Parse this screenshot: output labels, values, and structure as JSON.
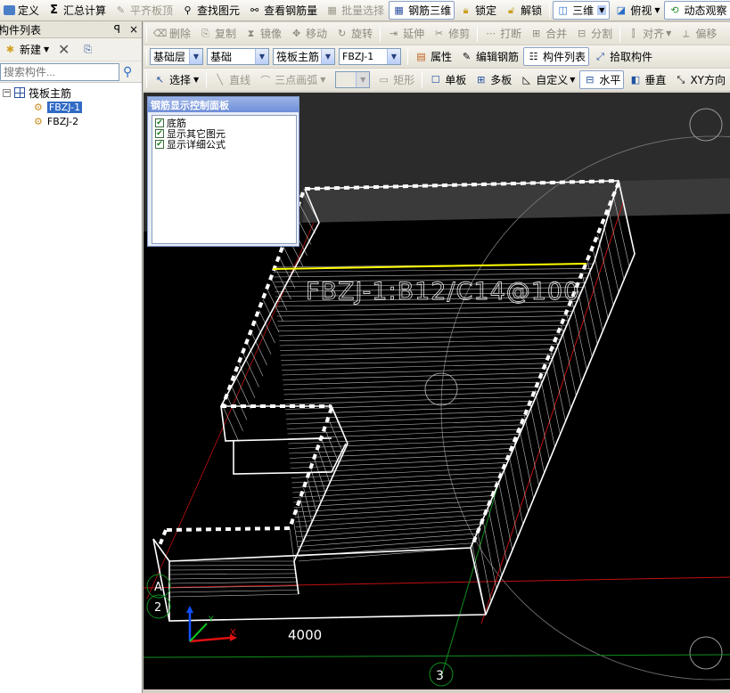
{
  "toolbar1": {
    "define": "定义",
    "sum": "汇总计算",
    "level": "平齐板顶",
    "find": "查找图元",
    "view_rebar": "查看钢筋量",
    "batch": "批量选择",
    "rebar3d": "钢筋三维",
    "lock": "锁定",
    "unlock": "解锁",
    "view_mode": "三维",
    "view_dir": "俯视",
    "dynamic": "动态观察"
  },
  "toolbar2": {
    "delete": "删除",
    "copy": "复制",
    "mirror": "镜像",
    "move": "移动",
    "rotate": "旋转",
    "extend": "延伸",
    "trim": "修剪",
    "break": "打断",
    "merge": "合并",
    "split": "分割",
    "align": "对齐",
    "offset": "偏移"
  },
  "toolbar3": {
    "floor": "基础层",
    "category": "基础",
    "type": "筏板主筋",
    "element": "FBZJ-1",
    "props": "属性",
    "edit_rebar": "编辑钢筋",
    "list": "构件列表",
    "pick": "拾取构件"
  },
  "toolbar4": {
    "select": "选择",
    "line": "直线",
    "arc": "三点画弧",
    "rect": "矩形",
    "single": "单板",
    "multi": "多板",
    "custom": "自定义",
    "horizontal": "水平",
    "vertical": "垂直",
    "xy": "XY方向"
  },
  "panel": {
    "title": "构件列表",
    "pin": "ꟼ",
    "close": "×",
    "new": "新建",
    "search_placeholder": "搜索构件...",
    "tree": {
      "root": "筏板主筋",
      "items": [
        "FBZJ-1",
        "FBZJ-2"
      ]
    }
  },
  "control_panel": {
    "title": "钢筋显示控制面板",
    "options": [
      "底筋",
      "显示其它图元",
      "显示详细公式"
    ]
  },
  "viewport": {
    "annotation": "FBZJ-1:B12/C14@100",
    "dimension": "4000",
    "axis_labels": [
      "A",
      "2",
      "3"
    ],
    "colors": {
      "rebar": "#ffffff",
      "highlight": "#ffff00",
      "axis_red": "#e01010",
      "axis_green": "#10a020",
      "axis_blue": "#1050ff"
    }
  }
}
